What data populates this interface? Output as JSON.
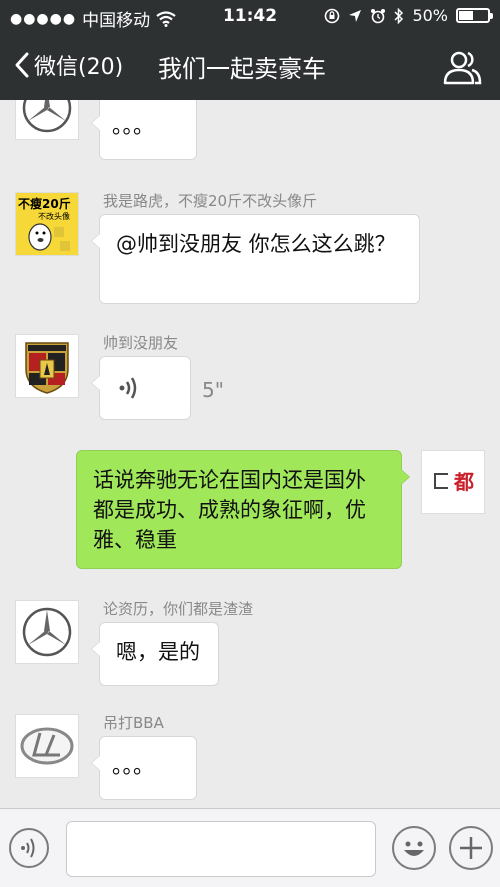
{
  "status_bar": {
    "signal_dots": "●●●●●",
    "carrier": "中国移动",
    "time": "11:42",
    "battery": "50%",
    "battery_level": 0.5
  },
  "nav": {
    "back_label": "微信(20)",
    "title": "我们一起卖豪车"
  },
  "messages": [
    {
      "sender": "",
      "avatar": "mercedes-logo",
      "text": "。。。"
    },
    {
      "sender": "我是路虎，不瘦20斤不改头像斤",
      "avatar": "cartoon-avatar",
      "avatar_text": [
        "不瘦20斤",
        "不改头像"
      ],
      "text": "@帅到没朋友 你怎么这么跳？"
    },
    {
      "sender": "帅到没朋友",
      "avatar": "porsche-logo",
      "voice_duration": "5\""
    },
    {
      "sender": "",
      "avatar": "self-avatar",
      "avatar_text": "都",
      "self": true,
      "text": "话说奔驰无论在国内还是国外都是成功、成熟的象征啊，优雅、稳重"
    },
    {
      "sender": "论资历，你们都是渣渣",
      "avatar": "mercedes-logo",
      "text": "嗯，是的"
    },
    {
      "sender": "吊打BBA",
      "avatar": "lexus-logo",
      "text": "。。。"
    }
  ],
  "colors": {
    "bar": "#2e3132",
    "self_bubble": "#a0e75a",
    "background": "#ebebeb"
  }
}
